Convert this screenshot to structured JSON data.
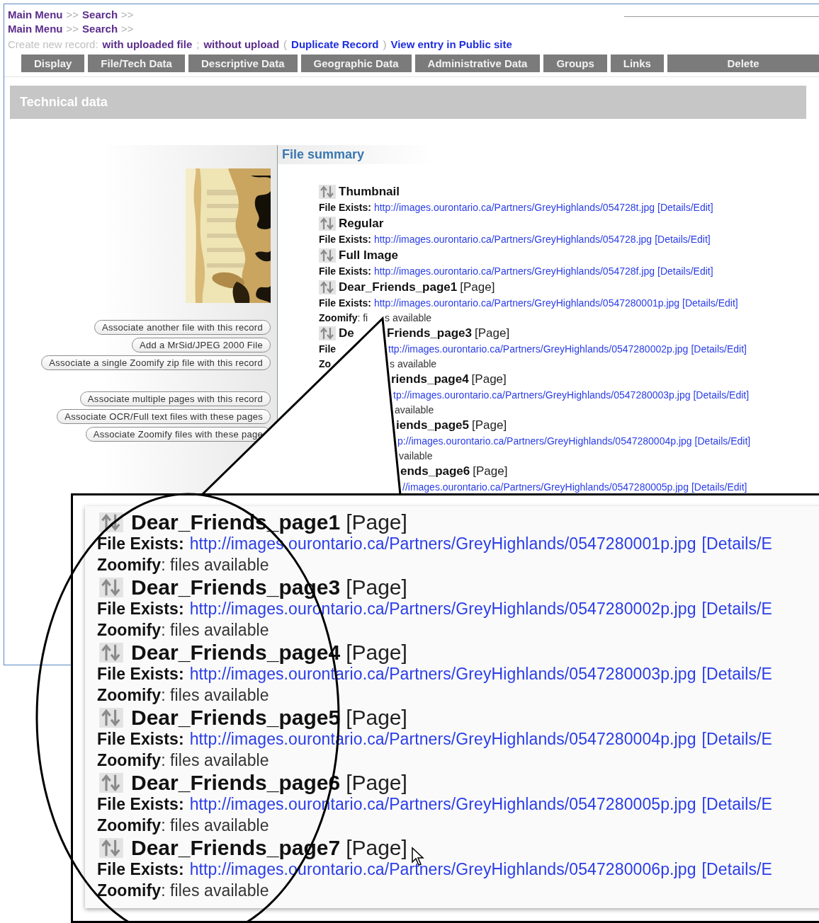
{
  "breadcrumbs": [
    [
      {
        "kind": "link",
        "text": "Main Menu"
      },
      {
        "kind": "sep",
        "text": ">>"
      },
      {
        "kind": "link",
        "text": "Search"
      },
      {
        "kind": "sep",
        "text": ">>"
      }
    ],
    [
      {
        "kind": "link",
        "text": "Main Menu"
      },
      {
        "kind": "sep",
        "text": ">>"
      },
      {
        "kind": "link",
        "text": "Search"
      },
      {
        "kind": "sep",
        "text": ">>"
      }
    ]
  ],
  "record_actions": [
    {
      "kind": "label",
      "text": "Create new record:"
    },
    {
      "kind": "link",
      "text": "with uploaded file"
    },
    {
      "kind": "sep",
      "text": ";"
    },
    {
      "kind": "link",
      "text": "without upload"
    },
    {
      "kind": "sep",
      "text": "("
    },
    {
      "kind": "action",
      "text": "Duplicate Record"
    },
    {
      "kind": "sep",
      "text": ")"
    },
    {
      "kind": "action",
      "text": "View entry in Public site"
    }
  ],
  "tabs": [
    "Display",
    "File/Tech Data",
    "Descriptive Data",
    "Geographic Data",
    "Administrative Data",
    "Groups",
    "Links",
    "Delete"
  ],
  "section_title": "Technical data",
  "file_summary": {
    "title": "File summary",
    "button_groups": [
      [
        "Associate another file with this record",
        "Add a MrSid/JPEG 2000 File",
        "Associate a single Zoomify zip file with this record"
      ],
      [
        "Associate multiple pages with this record",
        "Associate OCR/Full text files with these pages",
        "Associate Zoomify files with these page"
      ]
    ],
    "lines": [
      {
        "kind": "title",
        "left": [
          {
            "kind": "icon"
          },
          {
            "kind": "name",
            "text": "Thumbnail"
          }
        ]
      },
      {
        "kind": "file",
        "left": [
          {
            "kind": "label",
            "text": "File Exists:"
          },
          {
            "kind": "link",
            "text": "http://images.ourontario.ca/Partners/GreyHighlands/054728t.jpg"
          },
          {
            "kind": "details",
            "text": "[Details/Edit]"
          }
        ]
      },
      {
        "kind": "title",
        "left": [
          {
            "kind": "icon"
          },
          {
            "kind": "name",
            "text": "Regular"
          }
        ]
      },
      {
        "kind": "file",
        "left": [
          {
            "kind": "label",
            "text": "File Exists:"
          },
          {
            "kind": "link",
            "text": "http://images.ourontario.ca/Partners/GreyHighlands/054728.jpg"
          },
          {
            "kind": "details",
            "text": "[Details/Edit]"
          }
        ]
      },
      {
        "kind": "title",
        "left": [
          {
            "kind": "icon"
          },
          {
            "kind": "name",
            "text": "Full Image"
          }
        ]
      },
      {
        "kind": "file",
        "left": [
          {
            "kind": "label",
            "text": "File Exists:"
          },
          {
            "kind": "link",
            "text": "http://images.ourontario.ca/Partners/GreyHighlands/054728f.jpg"
          },
          {
            "kind": "details",
            "text": "[Details/Edit]"
          }
        ]
      },
      {
        "kind": "title",
        "left": [
          {
            "kind": "icon"
          },
          {
            "kind": "name",
            "text": "Dear_Friends_page1"
          },
          {
            "kind": "tag",
            "text": "[Page]"
          }
        ]
      },
      {
        "kind": "file",
        "left": [
          {
            "kind": "label",
            "text": "File Exists:"
          },
          {
            "kind": "link",
            "text": "http://images.ourontario.ca/Partners/GreyHighlands/0547280001p.jpg"
          },
          {
            "kind": "details",
            "text": "[Details/Edit]"
          }
        ]
      },
      {
        "kind": "zoomify",
        "left": [
          {
            "kind": "label",
            "text": "Zoomify"
          },
          {
            "kind": "plain",
            "text": ": fi"
          }
        ],
        "right": [
          {
            "kind": "plain",
            "text": "s available"
          }
        ]
      },
      {
        "kind": "title",
        "left": [
          {
            "kind": "icon"
          },
          {
            "kind": "name",
            "text": "De"
          }
        ],
        "right": [
          {
            "kind": "name",
            "text": "Friends_page3"
          },
          {
            "kind": "tag",
            "text": "[Page]"
          }
        ]
      },
      {
        "kind": "file",
        "left": [
          {
            "kind": "label",
            "text": "File"
          }
        ],
        "right": [
          {
            "kind": "link",
            "text": "ttp://images.ourontario.ca/Partners/GreyHighlands/0547280002p.jpg"
          },
          {
            "kind": "details",
            "text": "[Details/Edit]"
          }
        ]
      },
      {
        "kind": "zoomify",
        "left": [
          {
            "kind": "label",
            "text": "Zo"
          }
        ],
        "right": [
          {
            "kind": "plain",
            "text": "s available"
          }
        ]
      },
      {
        "kind": "title",
        "right": [
          {
            "kind": "name",
            "text": "riends_page4"
          },
          {
            "kind": "tag",
            "text": "[Page]"
          }
        ]
      },
      {
        "kind": "file",
        "right": [
          {
            "kind": "link",
            "text": "tp://images.ourontario.ca/Partners/GreyHighlands/0547280003p.jpg"
          },
          {
            "kind": "details",
            "text": "[Details/Edit]"
          }
        ]
      },
      {
        "kind": "zoomify",
        "right": [
          {
            "kind": "plain",
            "text": "available"
          }
        ]
      },
      {
        "kind": "title",
        "right": [
          {
            "kind": "name",
            "text": "iends_page5"
          },
          {
            "kind": "tag",
            "text": "[Page]"
          }
        ]
      },
      {
        "kind": "file",
        "right": [
          {
            "kind": "link",
            "text": "p://images.ourontario.ca/Partners/GreyHighlands/0547280004p.jpg"
          },
          {
            "kind": "details",
            "text": "[Details/Edit]"
          }
        ]
      },
      {
        "kind": "zoomify",
        "right": [
          {
            "kind": "plain",
            "text": "vailable"
          }
        ]
      },
      {
        "kind": "title",
        "right": [
          {
            "kind": "name",
            "text": "ends_page6"
          },
          {
            "kind": "tag",
            "text": "[Page]"
          }
        ]
      },
      {
        "kind": "file",
        "right": [
          {
            "kind": "link",
            "text": "//images.ourontario.ca/Partners/GreyHighlands/0547280005p.jpg"
          },
          {
            "kind": "details",
            "text": "[Details/Edit]"
          }
        ]
      }
    ]
  },
  "zoom_callout": {
    "lines": [
      {
        "kind": "title",
        "left": [
          {
            "kind": "icon"
          },
          {
            "kind": "name",
            "text": "Dear_Friends_page1"
          },
          {
            "kind": "tag",
            "text": "[Page]"
          }
        ]
      },
      {
        "kind": "file",
        "left": [
          {
            "kind": "label",
            "text": "File Exists:"
          },
          {
            "kind": "link",
            "text": "http://images.ourontario.ca/Partners/GreyHighlands/0547280001p.jpg"
          },
          {
            "kind": "details",
            "text": "[Details/E"
          }
        ]
      },
      {
        "kind": "zoomify",
        "left": [
          {
            "kind": "label",
            "text": "Zoomify"
          },
          {
            "kind": "plain",
            "text": ": files available"
          }
        ]
      },
      {
        "kind": "title",
        "left": [
          {
            "kind": "icon"
          },
          {
            "kind": "name",
            "text": "Dear_Friends_page3"
          },
          {
            "kind": "tag",
            "text": "[Page]"
          }
        ]
      },
      {
        "kind": "file",
        "left": [
          {
            "kind": "label",
            "text": "File Exists:"
          },
          {
            "kind": "link",
            "text": "http://images.ourontario.ca/Partners/GreyHighlands/0547280002p.jpg"
          },
          {
            "kind": "details",
            "text": "[Details/E"
          }
        ]
      },
      {
        "kind": "zoomify",
        "left": [
          {
            "kind": "label",
            "text": "Zoomify"
          },
          {
            "kind": "plain",
            "text": ": files available"
          }
        ]
      },
      {
        "kind": "title",
        "left": [
          {
            "kind": "icon"
          },
          {
            "kind": "name",
            "text": "Dear_Friends_page4"
          },
          {
            "kind": "tag",
            "text": "[Page]"
          }
        ]
      },
      {
        "kind": "file",
        "left": [
          {
            "kind": "label",
            "text": "File Exists:"
          },
          {
            "kind": "link",
            "text": "http://images.ourontario.ca/Partners/GreyHighlands/0547280003p.jpg"
          },
          {
            "kind": "details",
            "text": "[Details/E"
          }
        ]
      },
      {
        "kind": "zoomify",
        "left": [
          {
            "kind": "label",
            "text": "Zoomify"
          },
          {
            "kind": "plain",
            "text": ": files available"
          }
        ]
      },
      {
        "kind": "title",
        "left": [
          {
            "kind": "icon"
          },
          {
            "kind": "name",
            "text": "Dear_Friends_page5"
          },
          {
            "kind": "tag",
            "text": "[Page]"
          }
        ]
      },
      {
        "kind": "file",
        "left": [
          {
            "kind": "label",
            "text": "File Exists:"
          },
          {
            "kind": "link",
            "text": "http://images.ourontario.ca/Partners/GreyHighlands/0547280004p.jpg"
          },
          {
            "kind": "details",
            "text": "[Details/E"
          }
        ]
      },
      {
        "kind": "zoomify",
        "left": [
          {
            "kind": "label",
            "text": "Zoomify"
          },
          {
            "kind": "plain",
            "text": ": files available"
          }
        ]
      },
      {
        "kind": "title",
        "left": [
          {
            "kind": "icon"
          },
          {
            "kind": "name",
            "text": "Dear_Friends_page6"
          },
          {
            "kind": "tag",
            "text": "[Page]"
          }
        ]
      },
      {
        "kind": "file",
        "left": [
          {
            "kind": "label",
            "text": "File Exists:"
          },
          {
            "kind": "link",
            "text": "http://images.ourontario.ca/Partners/GreyHighlands/0547280005p.jpg"
          },
          {
            "kind": "details",
            "text": "[Details/E"
          }
        ]
      },
      {
        "kind": "zoomify",
        "left": [
          {
            "kind": "label",
            "text": "Zoomify"
          },
          {
            "kind": "plain",
            "text": ": files available"
          }
        ]
      },
      {
        "kind": "title",
        "left": [
          {
            "kind": "icon"
          },
          {
            "kind": "name",
            "text": "Dear_Friends_page7"
          },
          {
            "kind": "tag",
            "text": "[Page]"
          }
        ]
      },
      {
        "kind": "file",
        "left": [
          {
            "kind": "label",
            "text": "File Exists:"
          },
          {
            "kind": "link",
            "text": "http://images.ourontario.ca/Partners/GreyHighlands/0547280006p.jpg"
          },
          {
            "kind": "details",
            "text": "[Details/E"
          }
        ]
      },
      {
        "kind": "zoomify",
        "left": [
          {
            "kind": "label",
            "text": "Zoomify"
          },
          {
            "kind": "plain",
            "text": ": files available"
          }
        ]
      }
    ]
  }
}
